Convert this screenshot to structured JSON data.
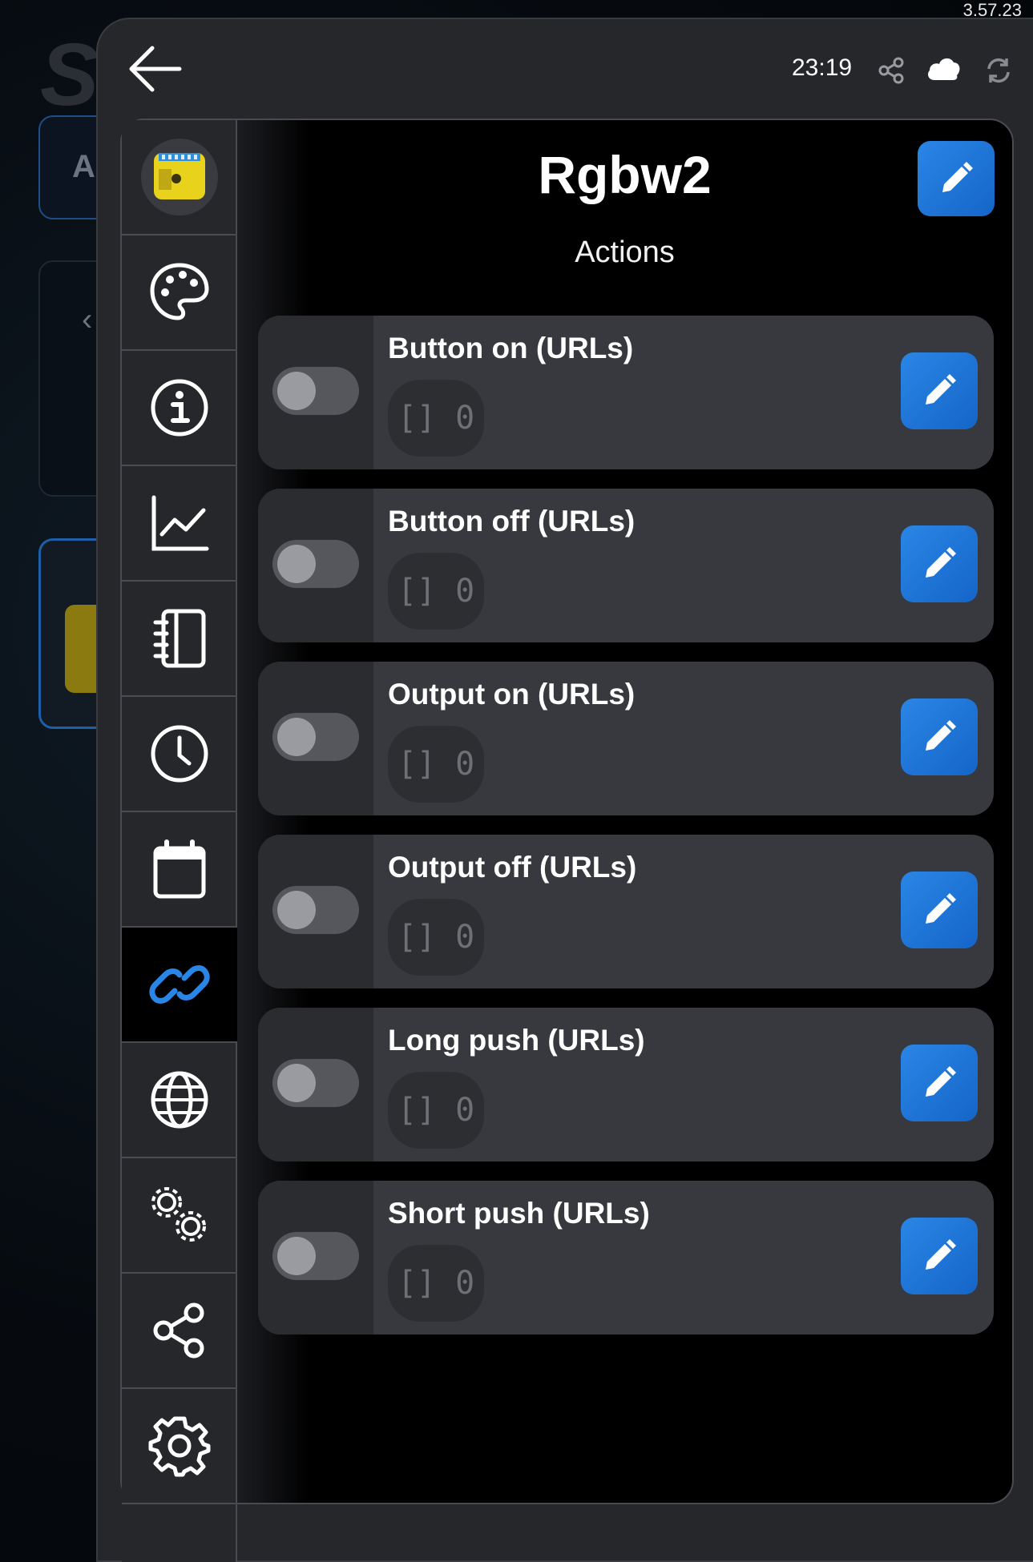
{
  "background": {
    "logo_text": "S",
    "card_letter": "A",
    "version": "3.57.23"
  },
  "topbar": {
    "back_icon": "arrow-left-icon",
    "time": "23:19",
    "icons": [
      "share-icon",
      "cloud-icon",
      "sync-icon"
    ]
  },
  "sidebar": {
    "items": [
      {
        "name": "device",
        "icon": "device-icon"
      },
      {
        "name": "appearance",
        "icon": "palette-icon"
      },
      {
        "name": "info",
        "icon": "info-icon"
      },
      {
        "name": "statistics",
        "icon": "chart-icon"
      },
      {
        "name": "notes",
        "icon": "notebook-icon"
      },
      {
        "name": "timer",
        "icon": "clock-icon"
      },
      {
        "name": "schedule",
        "icon": "calendar-icon"
      },
      {
        "name": "actions",
        "icon": "link-icon",
        "active": true
      },
      {
        "name": "web",
        "icon": "globe-icon"
      },
      {
        "name": "advanced",
        "icon": "gears-icon"
      },
      {
        "name": "sharing",
        "icon": "share-icon"
      },
      {
        "name": "settings",
        "icon": "gear-icon"
      }
    ]
  },
  "main": {
    "title": "Rgbw2",
    "subtitle": "Actions",
    "actions": [
      {
        "label": "Button on (URLs)",
        "value": "[] 0",
        "enabled": false
      },
      {
        "label": "Button off (URLs)",
        "value": "[] 0",
        "enabled": false
      },
      {
        "label": "Output on (URLs)",
        "value": "[] 0",
        "enabled": false
      },
      {
        "label": "Output off (URLs)",
        "value": "[] 0",
        "enabled": false
      },
      {
        "label": "Long push (URLs)",
        "value": "[] 0",
        "enabled": false
      },
      {
        "label": "Short push (URLs)",
        "value": "[] 0",
        "enabled": false
      }
    ]
  },
  "colors": {
    "accent": "#1e75d8",
    "dialog_bg": "#26272b",
    "card_bg": "#38393e",
    "active_icon": "#2a86e6"
  }
}
